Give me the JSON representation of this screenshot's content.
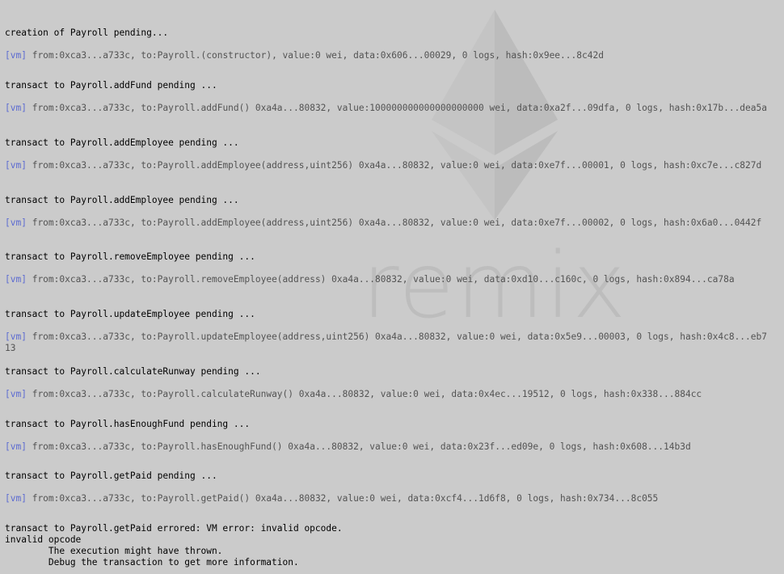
{
  "watermark": {
    "text": "remix"
  },
  "log": [
    {
      "status": "creation of Payroll pending...",
      "tag": "[vm]",
      "detail": "from:0xca3...a733c, to:Payroll.(constructor), value:0 wei, data:0x606...00029, 0 logs, hash:0x9ee...8c42d"
    },
    {
      "status": "transact to Payroll.addFund pending ...",
      "tag": "[vm]",
      "detail": "from:0xca3...a733c, to:Payroll.addFund() 0xa4a...80832, value:100000000000000000000 wei, data:0xa2f...09dfa, 0 logs, hash:0x17b...dea5a"
    },
    {
      "status": "transact to Payroll.addEmployee pending ...",
      "tag": "[vm]",
      "detail": "from:0xca3...a733c, to:Payroll.addEmployee(address,uint256) 0xa4a...80832, value:0 wei, data:0xe7f...00001, 0 logs, hash:0xc7e...c827d"
    },
    {
      "status": "transact to Payroll.addEmployee pending ...",
      "tag": "[vm]",
      "detail": "from:0xca3...a733c, to:Payroll.addEmployee(address,uint256) 0xa4a...80832, value:0 wei, data:0xe7f...00002, 0 logs, hash:0x6a0...0442f"
    },
    {
      "status": "transact to Payroll.removeEmployee pending ...",
      "tag": "[vm]",
      "detail": "from:0xca3...a733c, to:Payroll.removeEmployee(address) 0xa4a...80832, value:0 wei, data:0xd10...c160c, 0 logs, hash:0x894...ca78a"
    },
    {
      "status": "transact to Payroll.updateEmployee pending ...",
      "tag": "[vm]",
      "detail": "from:0xca3...a733c, to:Payroll.updateEmployee(address,uint256) 0xa4a...80832, value:0 wei, data:0x5e9...00003, 0 logs, hash:0x4c8...eb713"
    },
    {
      "status": "transact to Payroll.calculateRunway pending ...",
      "tag": "[vm]",
      "detail": "from:0xca3...a733c, to:Payroll.calculateRunway() 0xa4a...80832, value:0 wei, data:0x4ec...19512, 0 logs, hash:0x338...884cc"
    },
    {
      "status": "transact to Payroll.hasEnoughFund pending ...",
      "tag": "[vm]",
      "detail": "from:0xca3...a733c, to:Payroll.hasEnoughFund() 0xa4a...80832, value:0 wei, data:0x23f...ed09e, 0 logs, hash:0x608...14b3d"
    },
    {
      "status": "transact to Payroll.getPaid pending ...",
      "tag": "[vm]",
      "detail": "from:0xca3...a733c, to:Payroll.getPaid() 0xa4a...80832, value:0 wei, data:0xcf4...1d6f8, 0 logs, hash:0x734...8c055"
    }
  ],
  "error": {
    "line1": "transact to Payroll.getPaid errored: VM error: invalid opcode.",
    "line2": "invalid opcode",
    "line3": "        The execution might have thrown.",
    "line4": "        Debug the transaction to get more information."
  }
}
